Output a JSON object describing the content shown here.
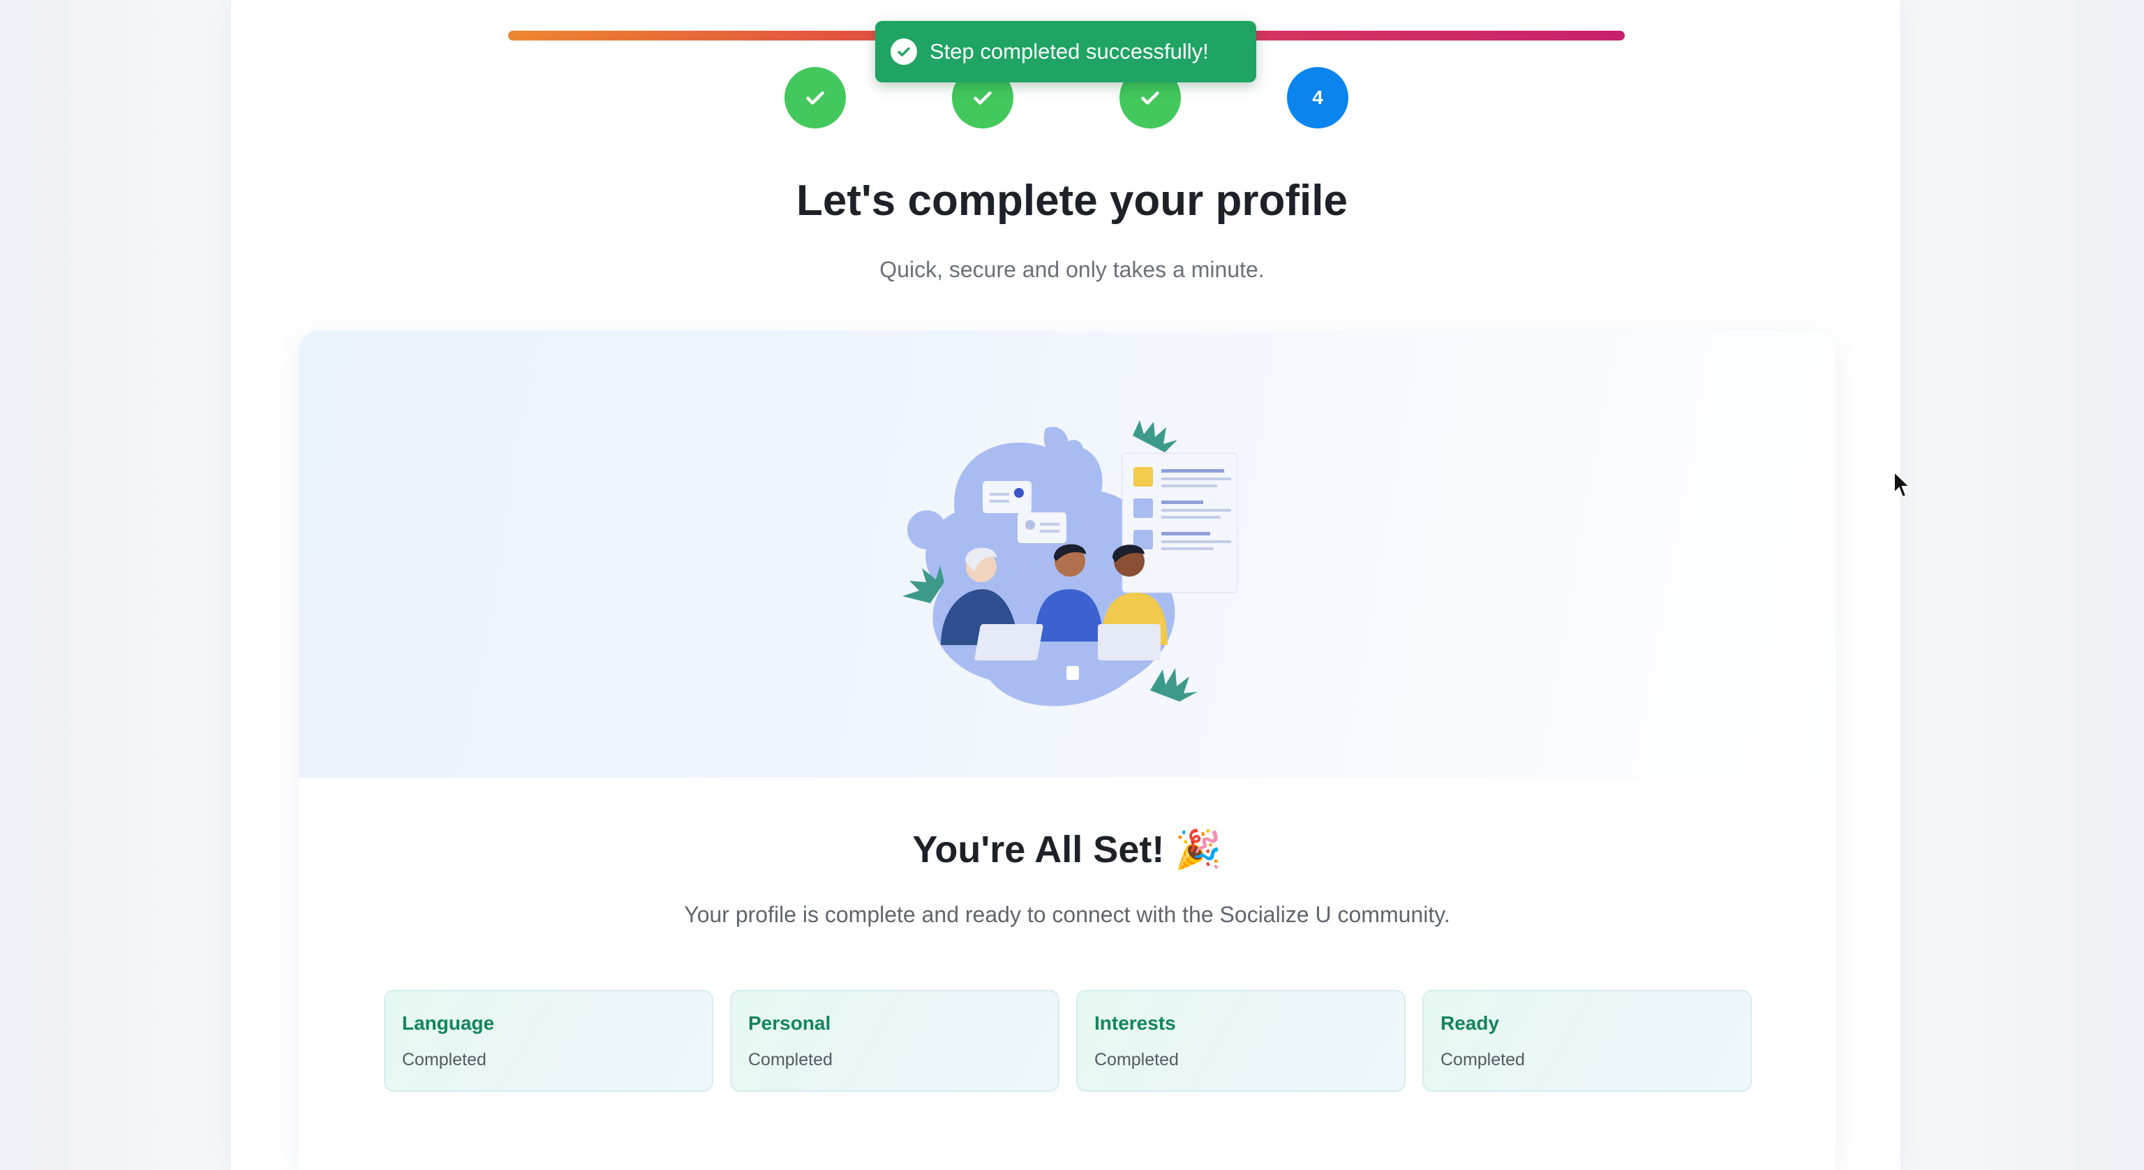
{
  "stepper": {
    "steps": [
      {
        "state": "completed",
        "label": ""
      },
      {
        "state": "completed",
        "label": ""
      },
      {
        "state": "completed",
        "label": ""
      },
      {
        "state": "active",
        "label": "4"
      }
    ],
    "colors": {
      "completed": "#43c85d",
      "active": "#0c84ee",
      "progress_start": "#ec8630",
      "progress_end": "#c8206c"
    }
  },
  "toast": {
    "message": "Step completed successfully!",
    "color": "#1fa464",
    "icon": "check-circle-icon"
  },
  "header": {
    "title": "Let's complete your profile",
    "subtitle": "Quick, secure and only takes a minute."
  },
  "completion": {
    "title": "You're All Set! 🎉",
    "description": "Your profile is complete and ready to connect with the Socialize U community.",
    "summary": [
      {
        "name": "Language",
        "status": "Completed"
      },
      {
        "name": "Personal",
        "status": "Completed"
      },
      {
        "name": "Interests",
        "status": "Completed"
      },
      {
        "name": "Ready",
        "status": "Completed"
      }
    ],
    "accent": "#12855a"
  }
}
